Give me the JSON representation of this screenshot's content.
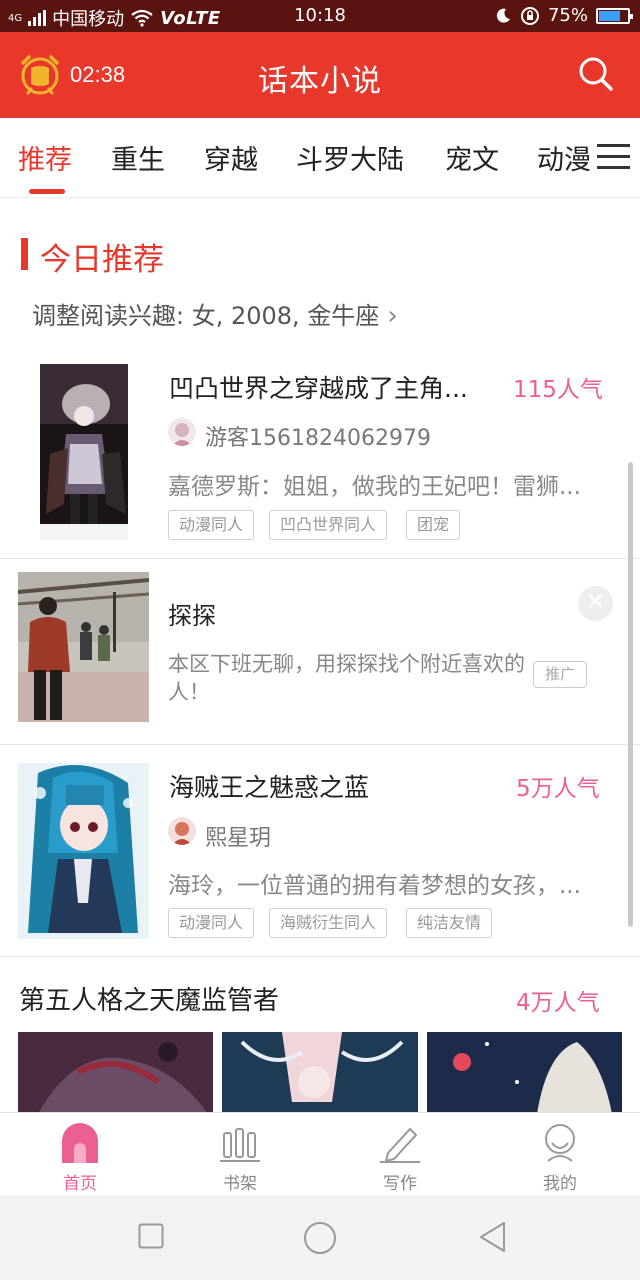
{
  "status_bar": {
    "network": "4G",
    "carrier": "中国移动",
    "volte": "VoLTE",
    "time": "10:18",
    "battery": "75%",
    "battery_level": 0.75
  },
  "header": {
    "timer": "02:38",
    "title": "话本小说"
  },
  "tabs": [
    "推荐",
    "重生",
    "穿越",
    "斗罗大陆",
    "宠文",
    "动漫"
  ],
  "active_tab": 0,
  "section": {
    "title": "今日推荐",
    "interest": "调整阅读兴趣: 女, 2008, 金牛座"
  },
  "books": [
    {
      "title": "凹凸世界之穿越成了主角...",
      "popularity": "115人气",
      "author": "游客1561824062979",
      "desc": "嘉德罗斯：姐姐，做我的王妃吧！雷狮...",
      "tags": [
        "动漫同人",
        "凹凸世界同人",
        "团宠"
      ]
    },
    {
      "title": "海贼王之魅惑之蓝",
      "popularity": "5万人气",
      "author": "熙星玥",
      "desc": "海玲，一位普通的拥有着梦想的女孩，...",
      "tags": [
        "动漫同人",
        "海贼衍生同人",
        "纯洁友情"
      ]
    },
    {
      "title": "第五人格之天魔监管者",
      "popularity": "4万人气"
    }
  ],
  "ad": {
    "title": "探探",
    "desc": "本区下班无聊，用探探找个附近喜欢的人！",
    "badge": "推广"
  },
  "bottom_nav": [
    {
      "label": "首页",
      "icon": "home-icon"
    },
    {
      "label": "书架",
      "icon": "bookshelf-icon"
    },
    {
      "label": "写作",
      "icon": "pencil-icon"
    },
    {
      "label": "我的",
      "icon": "profile-icon"
    }
  ],
  "colors": {
    "primary": "#e8382c",
    "status_bar": "#5a1410",
    "popularity": "#ec5f93",
    "active_nav": "#ec5f93"
  }
}
